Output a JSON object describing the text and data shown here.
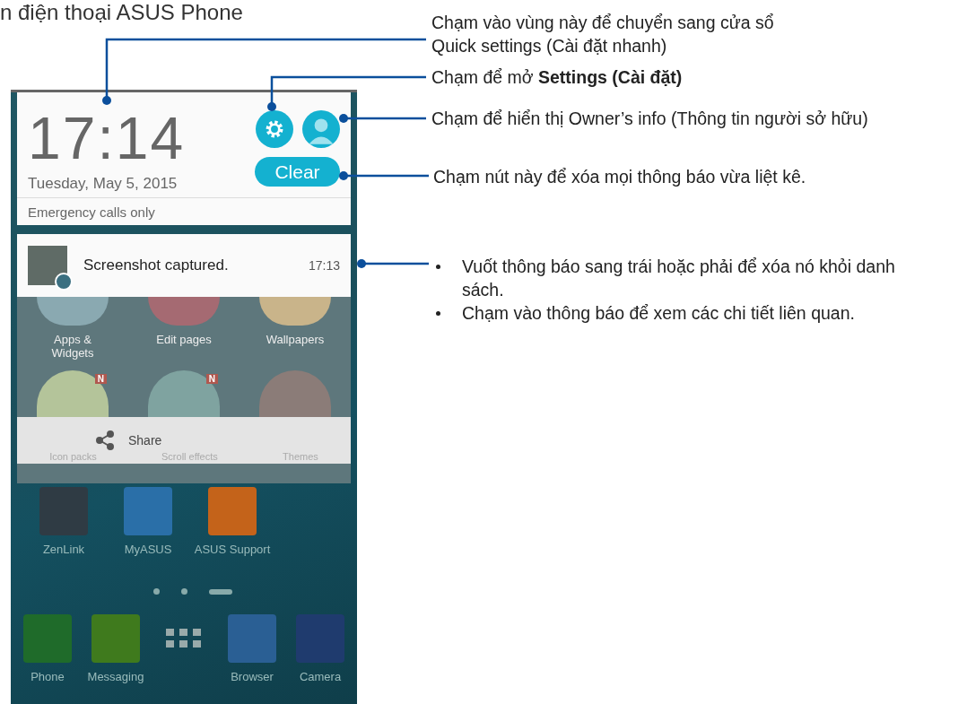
{
  "page_heading": "n điện thoại ASUS Phone",
  "phone": {
    "clock": "17:14",
    "date": "Tuesday, May 5, 2015",
    "clear_button": "Clear",
    "status": "Emergency calls only",
    "notification": {
      "text": "Screenshot captured.",
      "time": "17:13"
    },
    "menu": [
      {
        "label": "Apps &\nWidgets"
      },
      {
        "label": "Edit pages"
      },
      {
        "label": "Wallpapers"
      },
      {
        "label": "Icon packs",
        "badge": "N"
      },
      {
        "label": "Scroll effects",
        "badge": "N"
      },
      {
        "label": "Themes"
      }
    ],
    "share": "Share",
    "apps": [
      {
        "label": "ZenLink"
      },
      {
        "label": "MyASUS"
      },
      {
        "label": "ASUS Support"
      }
    ],
    "page_dots": [
      {
        "selected": false
      },
      {
        "selected": false
      },
      {
        "selected": true
      }
    ],
    "dock": [
      {
        "kind": "app",
        "label": "Phone"
      },
      {
        "kind": "app",
        "label": "Messaging"
      },
      {
        "kind": "drawer"
      },
      {
        "kind": "app",
        "label": "Browser"
      },
      {
        "kind": "app",
        "label": "Camera"
      }
    ]
  },
  "callouts": [
    {
      "kind": "text",
      "text": "Chạm vào vùng này để chuyển sang cửa sổ Quick settings (Cài đặt nhanh)"
    },
    {
      "kind": "text",
      "text": "Chạm để mở **Settings (Cài đặt)**"
    },
    {
      "kind": "text",
      "text": "Chạm để hiển thị Owner’s info (Thông tin người sở hữu)"
    },
    {
      "kind": "text",
      "text": "Chạm nút này để xóa mọi thông báo vừa liệt kê."
    },
    {
      "kind": "bullets",
      "items": [
        "Vuốt thông báo sang trái hoặc phải để xóa nó khỏi danh sách.",
        "Chạm vào thông báo để xem các chi tiết liên quan."
      ]
    }
  ]
}
